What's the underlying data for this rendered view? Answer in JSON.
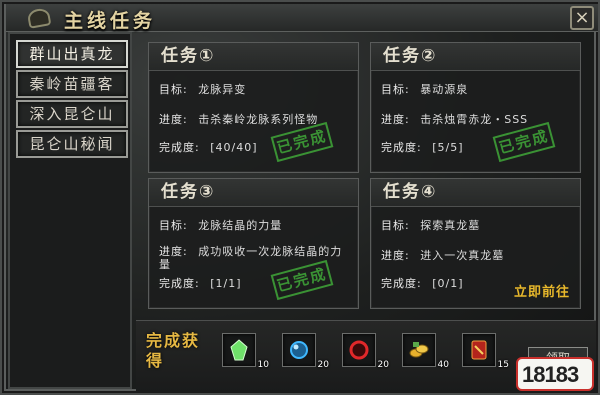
{
  "window": {
    "title": "主线任务",
    "close_label": "×"
  },
  "sidebar": {
    "items": [
      {
        "label": "群山出真龙",
        "active": true
      },
      {
        "label": "秦岭苗疆客",
        "active": false
      },
      {
        "label": "深入昆仑山",
        "active": false
      },
      {
        "label": "昆仑山秘闻",
        "active": false
      }
    ]
  },
  "quests": [
    {
      "title": "任务①",
      "target_label": "目标:",
      "target": "龙脉异变",
      "progress_label": "进度:",
      "progress": "击杀秦岭龙脉系列怪物",
      "completion_label": "完成度:",
      "completion": "[40/40]",
      "stamp": "已完成"
    },
    {
      "title": "任务②",
      "target_label": "目标:",
      "target": "暴动源泉",
      "progress_label": "进度:",
      "progress": "击杀烛霄赤龙・SSS",
      "completion_label": "完成度:",
      "completion": "[5/5]",
      "stamp": "已完成"
    },
    {
      "title": "任务③",
      "target_label": "目标:",
      "target": "龙脉结晶的力量",
      "progress_label": "进度:",
      "progress": "成功吸收一次龙脉结晶的力量",
      "completion_label": "完成度:",
      "completion": "[1/1]",
      "stamp": "已完成"
    },
    {
      "title": "任务④",
      "target_label": "目标:",
      "target": "探索真龙墓",
      "progress_label": "进度:",
      "progress": "进入一次真龙墓",
      "completion_label": "完成度:",
      "completion": "[0/1]",
      "action": "立即前往"
    }
  ],
  "rewards": {
    "label": "完成获得",
    "items": [
      {
        "icon": "green-crystal-icon",
        "qty": "10",
        "color": "#6fe06a"
      },
      {
        "icon": "blue-orb-icon",
        "qty": "20",
        "color": "#3fb8ff"
      },
      {
        "icon": "red-orb-icon",
        "qty": "20",
        "color": "#e0282a"
      },
      {
        "icon": "gold-coins-icon",
        "qty": "40",
        "color": "#e7b02c"
      },
      {
        "icon": "red-talisman-icon",
        "qty": "15",
        "color": "#d63a2d"
      }
    ],
    "claim_label": "领取"
  },
  "watermark": {
    "text": "18183"
  },
  "colors": {
    "complete_green": "#57d24d",
    "incomplete_red": "#e23a33",
    "action_gold": "#e9b92b"
  }
}
